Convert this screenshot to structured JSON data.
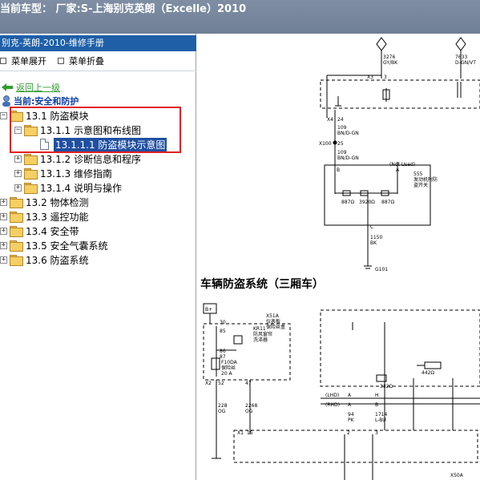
{
  "window": {
    "title": "当前车型： 厂家:S-上海别克英朗（Excelle）2010"
  },
  "sidebar": {
    "manual_title": "别克-英朗-2010-维修手册",
    "toolbar": {
      "expand_label": "菜单展开",
      "collapse_label": "菜单折叠"
    },
    "back_label": "返回上一级",
    "current_label": "当前:安全和防护",
    "tree": [
      {
        "label": "13.1 防盗模块",
        "expanded": true,
        "level": 0
      },
      {
        "label": "13.1.1 示意图和布线图",
        "expanded": true,
        "level": 1
      },
      {
        "label": "13.1.1.1 防盗模块示意图",
        "selected": true,
        "level": 2
      },
      {
        "label": "13.1.2 诊断信息和程序",
        "expanded": false,
        "level": 1
      },
      {
        "label": "13.1.3 维修指南",
        "expanded": false,
        "level": 1
      },
      {
        "label": "13.1.4 说明与操作",
        "expanded": false,
        "level": 1
      },
      {
        "label": "13.2 物体检测",
        "expanded": false,
        "level": 0
      },
      {
        "label": "13.3 遥控功能",
        "expanded": false,
        "level": 0
      },
      {
        "label": "13.4 安全带",
        "expanded": false,
        "level": 0
      },
      {
        "label": "13.5 安全气囊系统",
        "expanded": false,
        "level": 0
      },
      {
        "label": "13.6 防盗系统",
        "expanded": false,
        "level": 0
      }
    ]
  },
  "diagram": {
    "section_title": "车辆防盗系统（三厢车）",
    "labels": {
      "w1": "3276",
      "w1c": "GY/BK",
      "w2": "7633",
      "w2c": "D-GN/VT",
      "x3": "X3",
      "p3": "3",
      "x4": "X4",
      "p24": "24",
      "w109": "109",
      "bn": "BN/D-GN",
      "x100": "X100",
      "p25": "25",
      "w109b": "109",
      "bnb": "BN/D-GN",
      "b": "B",
      "a": "A",
      "notused": "(Not Used)",
      "k555": "555",
      "k555d1": "发动机附防",
      "k555d2": "盗开关",
      "r1": "887Ω",
      "r2": "3920Ω",
      "r3": "887Ω",
      "c": "C",
      "w1150": "1150",
      "bk": "BK",
      "g101": "G101",
      "bplus": "B+",
      "x51a": "X51A",
      "x51ad1": "仪表板",
      "x51ad2": "保险丝盒",
      "p30": "30",
      "p85": "85",
      "p86": "86",
      "p87": "87",
      "kr11": "KR11",
      "kr11d1": "防风窗帘",
      "kr11d2": "洗涤器",
      "f": "F10DA",
      "fd1": "保险丝",
      "fd2": "20 A",
      "x2a": "X2",
      "p52": "52",
      "p47": "47",
      "w228": "228",
      "og": "OG",
      "w2268": "2268",
      "og2": "OG",
      "x1": "X1",
      "p15": "15",
      "r442": "442Ω",
      "r332": "332Ω",
      "lhd": "(LHD)",
      "rhd": "(RHD)",
      "pa1": "A",
      "ph": "H",
      "pa2": "A",
      "pb": "B",
      "w94": "94",
      "pk": "PK",
      "w1714": "1714",
      "lbu": "L-BU",
      "p2": "2",
      "p3b": "3",
      "x50a": "X50A"
    }
  }
}
